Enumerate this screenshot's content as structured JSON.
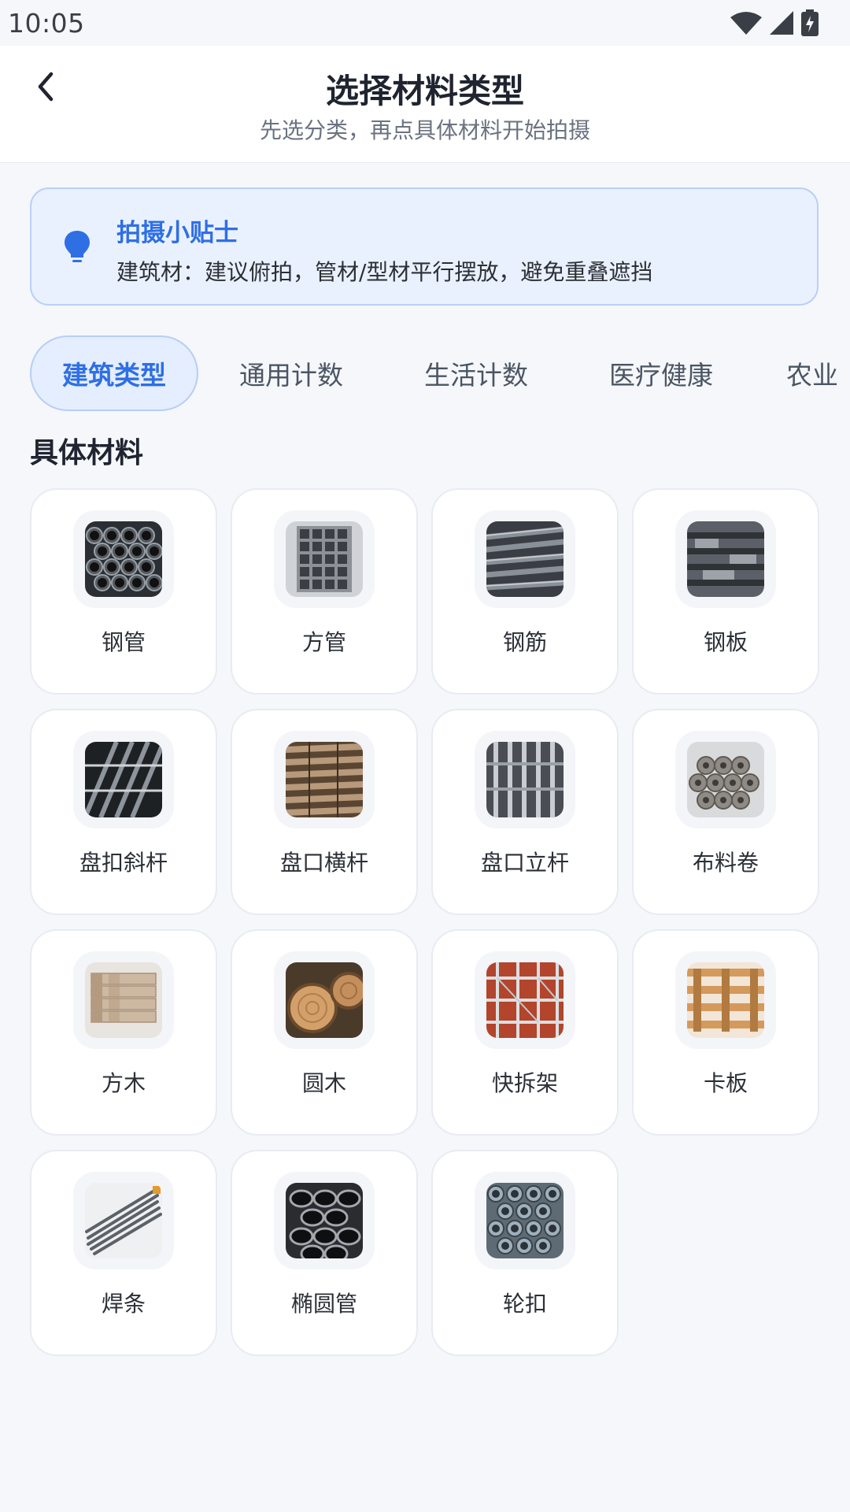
{
  "status_bar": {
    "time": "10:05"
  },
  "header": {
    "title": "选择材料类型",
    "subtitle": "先选分类，再点具体材料开始拍摄"
  },
  "tips": {
    "title": "拍摄小贴士",
    "text": "建筑材：建议俯拍，管材/型材平行摆放，避免重叠遮挡"
  },
  "tabs": [
    {
      "label": "建筑类型",
      "active": true
    },
    {
      "label": "通用计数",
      "active": false
    },
    {
      "label": "生活计数",
      "active": false
    },
    {
      "label": "医疗健康",
      "active": false
    },
    {
      "label": "农业",
      "active": false
    }
  ],
  "section_title": "具体材料",
  "materials": [
    {
      "label": "钢管",
      "icon": "steel-pipe-photo"
    },
    {
      "label": "方管",
      "icon": "square-tube-photo"
    },
    {
      "label": "钢筋",
      "icon": "rebar-photo"
    },
    {
      "label": "钢板",
      "icon": "steel-plate-photo"
    },
    {
      "label": "盘扣斜杆",
      "icon": "diagonal-rod-photo"
    },
    {
      "label": "盘口横杆",
      "icon": "horizontal-rod-photo"
    },
    {
      "label": "盘口立杆",
      "icon": "vertical-rod-photo"
    },
    {
      "label": "布料卷",
      "icon": "fabric-roll-photo"
    },
    {
      "label": "方木",
      "icon": "square-timber-photo"
    },
    {
      "label": "圆木",
      "icon": "round-log-photo"
    },
    {
      "label": "快拆架",
      "icon": "quick-scaffold-photo"
    },
    {
      "label": "卡板",
      "icon": "pallet-photo"
    },
    {
      "label": "焊条",
      "icon": "welding-rod-photo"
    },
    {
      "label": "椭圆管",
      "icon": "oval-tube-photo"
    },
    {
      "label": "轮扣",
      "icon": "wheel-buckle-photo"
    }
  ],
  "colors": {
    "accent": "#2f6fe4",
    "background": "#f5f7fb"
  }
}
